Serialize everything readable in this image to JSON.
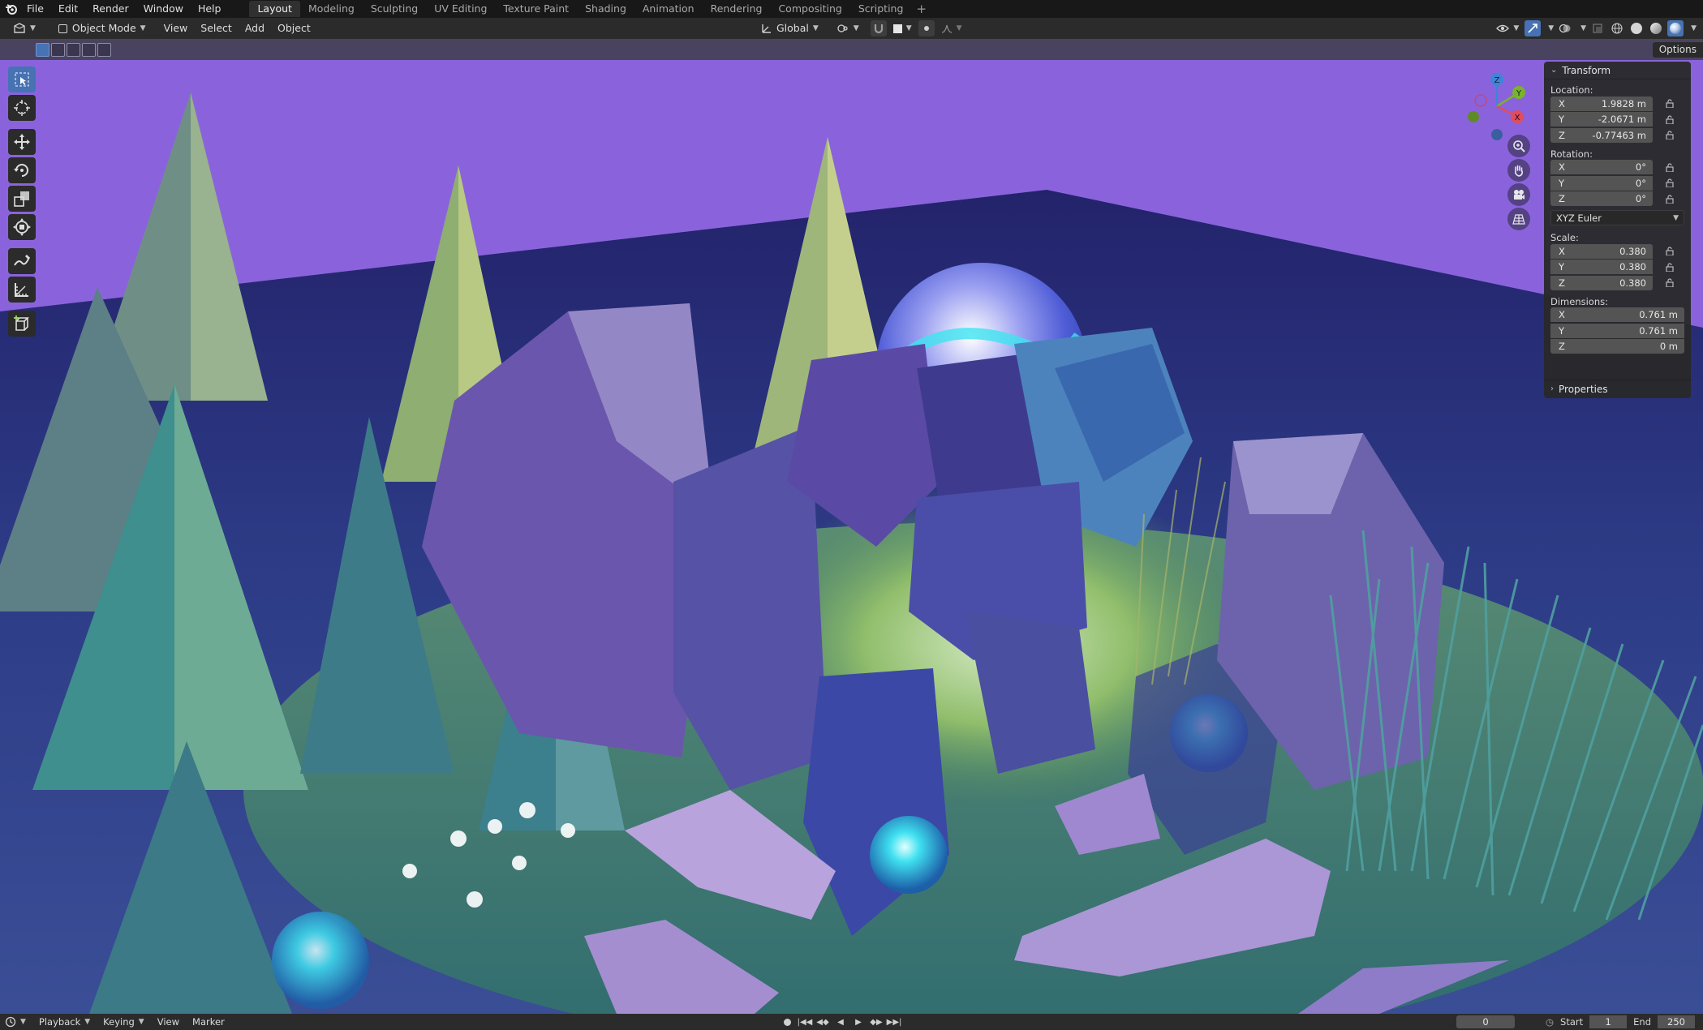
{
  "app": {
    "menu": [
      "File",
      "Edit",
      "Render",
      "Window",
      "Help"
    ],
    "workspace_tabs": [
      "Layout",
      "Modeling",
      "Sculpting",
      "UV Editing",
      "Texture Paint",
      "Shading",
      "Animation",
      "Rendering",
      "Compositing",
      "Scripting"
    ],
    "active_tab": "Layout",
    "add_tab": "+"
  },
  "header": {
    "mode": "Object Mode",
    "menus": [
      "View",
      "Select",
      "Add",
      "Object"
    ],
    "orientation": "Global"
  },
  "toolstrip": {
    "options_label": "Options"
  },
  "tools": [
    {
      "icon": "select-box-icon",
      "active": true
    },
    {
      "icon": "cursor-icon",
      "active": false
    },
    {
      "icon": "move-icon",
      "active": false
    },
    {
      "icon": "rotate-icon",
      "active": false
    },
    {
      "icon": "scale-icon",
      "active": false
    },
    {
      "icon": "transform-icon",
      "active": false
    },
    {
      "icon": "annotate-icon",
      "active": false
    },
    {
      "icon": "measure-icon",
      "active": false
    },
    {
      "icon": "add-cube-icon",
      "active": false
    }
  ],
  "gizmo": {
    "x": "X",
    "y": "Y",
    "z": "Z",
    "x_color": "#e14c5c",
    "y_color": "#7ab32a",
    "z_color": "#3f84d8"
  },
  "npanel": {
    "title": "Transform",
    "location_label": "Location:",
    "location": [
      {
        "axis": "X",
        "value": "1.9828 m"
      },
      {
        "axis": "Y",
        "value": "-2.0671 m"
      },
      {
        "axis": "Z",
        "value": "-0.77463 m"
      }
    ],
    "rotation_label": "Rotation:",
    "rotation": [
      {
        "axis": "X",
        "value": "0°"
      },
      {
        "axis": "Y",
        "value": "0°"
      },
      {
        "axis": "Z",
        "value": "0°"
      }
    ],
    "rotation_mode": "XYZ Euler",
    "scale_label": "Scale:",
    "scale": [
      {
        "axis": "X",
        "value": "0.380"
      },
      {
        "axis": "Y",
        "value": "0.380"
      },
      {
        "axis": "Z",
        "value": "0.380"
      }
    ],
    "dimensions_label": "Dimensions:",
    "dimensions": [
      {
        "axis": "X",
        "value": "0.761 m"
      },
      {
        "axis": "Y",
        "value": "0.761 m"
      },
      {
        "axis": "Z",
        "value": "0 m"
      }
    ],
    "properties_label": "Properties"
  },
  "timeline": {
    "menus": [
      "Playback",
      "Keying",
      "View",
      "Marker"
    ],
    "current_frame": "0",
    "start_label": "Start",
    "start": "1",
    "end_label": "End",
    "end": "250"
  },
  "colors": {
    "accent": "#4772b3",
    "sky": "#8c66dc",
    "tool_header": "#4a4360"
  }
}
